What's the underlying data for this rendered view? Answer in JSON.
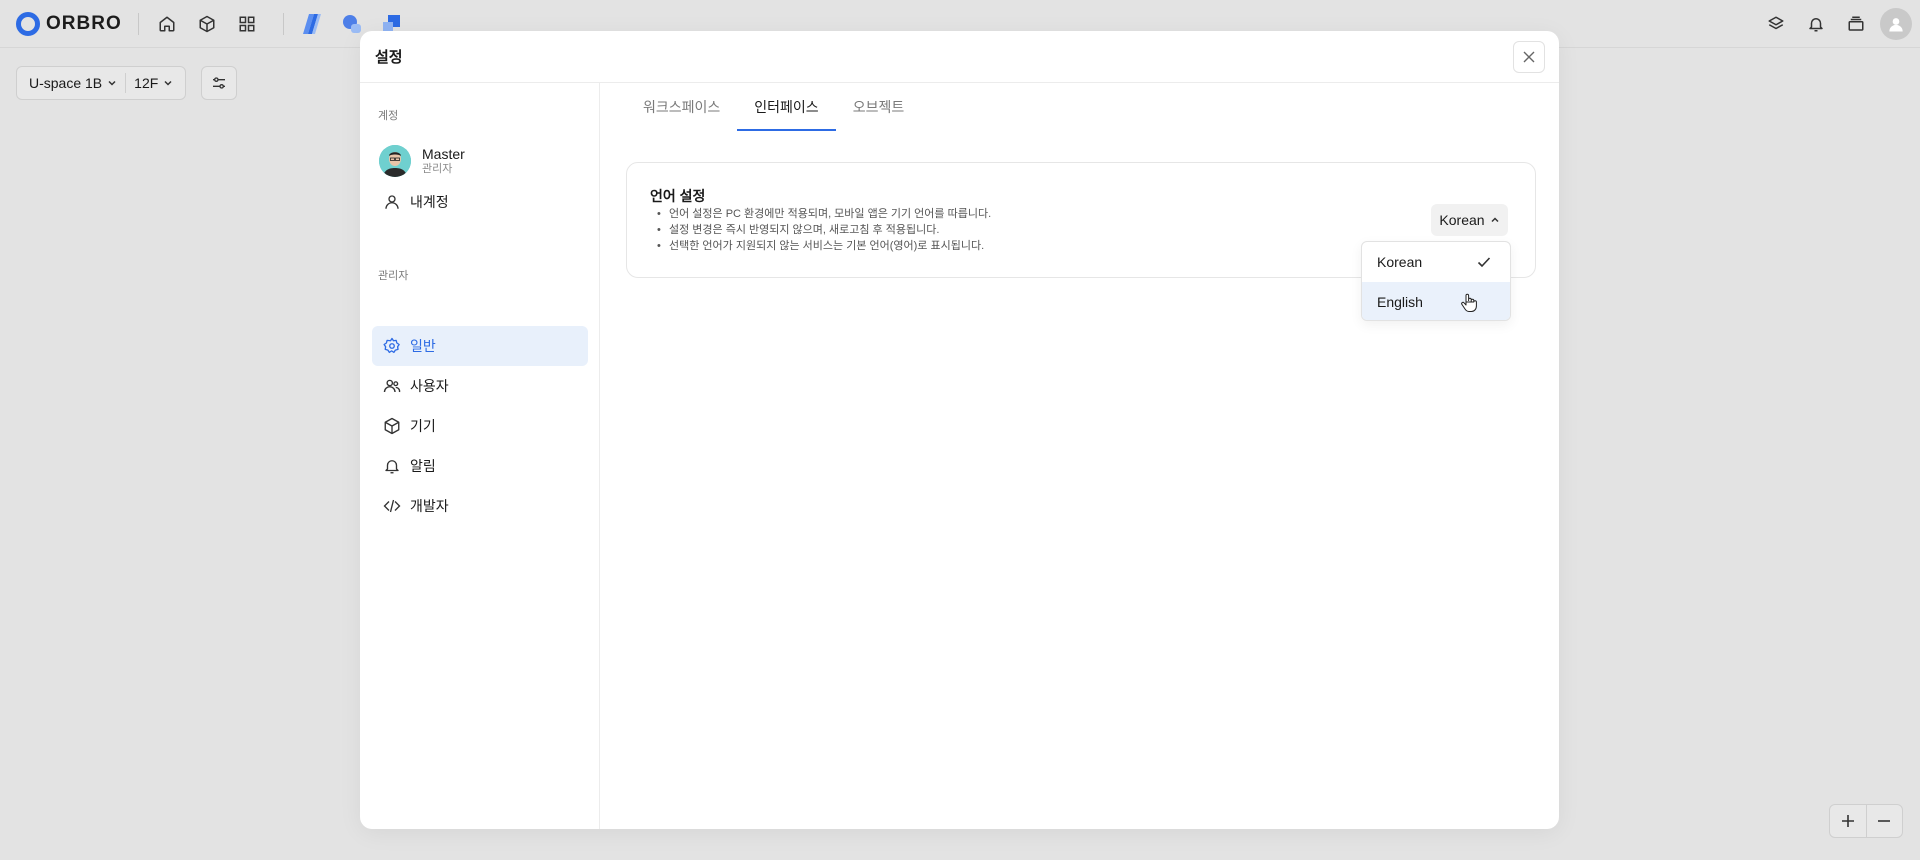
{
  "app": {
    "logo_text": "ORBRO"
  },
  "floor": {
    "building": "U-space 1B",
    "level": "12F"
  },
  "modal": {
    "title": "설정",
    "sidebar": {
      "account_label": "계정",
      "profile": {
        "name": "Master",
        "role": "관리자"
      },
      "my_account": "내계정",
      "admin_label": "관리자",
      "items": [
        {
          "label": "일반",
          "icon": "gear-icon",
          "active": true
        },
        {
          "label": "사용자",
          "icon": "users-icon"
        },
        {
          "label": "기기",
          "icon": "box-icon"
        },
        {
          "label": "알림",
          "icon": "bell-icon"
        },
        {
          "label": "개발자",
          "icon": "code-icon"
        }
      ]
    },
    "tabs": [
      {
        "label": "워크스페이스"
      },
      {
        "label": "인터페이스",
        "active": true
      },
      {
        "label": "오브젝트"
      }
    ],
    "language": {
      "title": "언어 설정",
      "notes": [
        "언어 설정은 PC 환경에만 적용되며, 모바일 앱은 기기 언어를 따릅니다.",
        "설정 변경은 즉시 반영되지 않으며, 새로고침 후 적용됩니다.",
        "선택한 언어가 지원되지 않는 서비스는 기본 언어(영어)로 표시됩니다."
      ],
      "selected": "Korean",
      "options": [
        {
          "label": "Korean",
          "checked": true
        },
        {
          "label": "English",
          "hovered": true
        }
      ]
    }
  },
  "colors": {
    "accent": "#2d6be4",
    "active_bg": "#e8f0fb",
    "background": "#e3e3e3"
  }
}
